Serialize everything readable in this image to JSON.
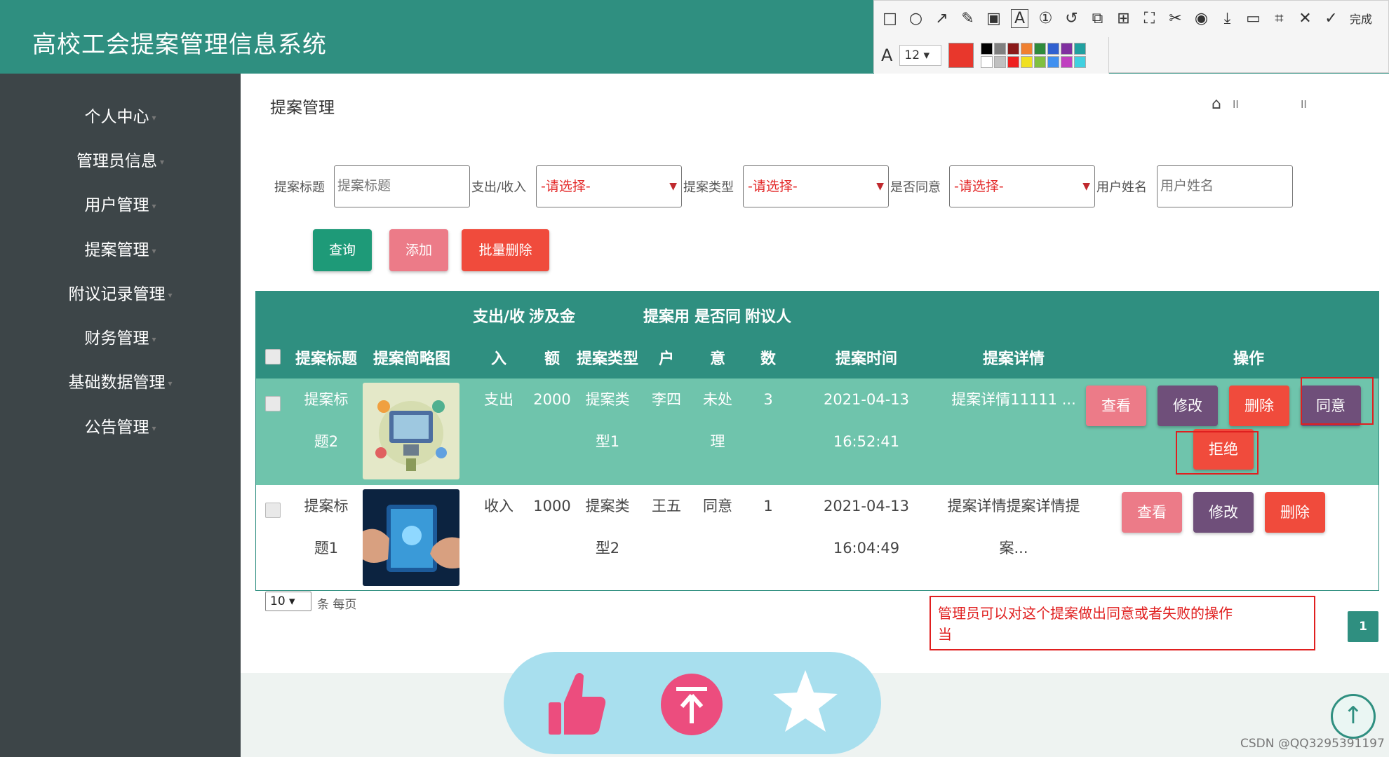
{
  "colors": {
    "primary": "#2f8f80",
    "sidebar": "#3d4548",
    "danger": "#f04b3c",
    "pink": "#ec7b88",
    "purple": "#6f4f7a",
    "row_highlight": "#6fc4ac"
  },
  "header": {
    "title": "高校工会提案管理信息系统"
  },
  "toolbar": {
    "done_label": "完成",
    "font_size": "12",
    "palette": [
      "#000000",
      "#808080",
      "#8b1a1a",
      "#f08030",
      "#2e8b3c",
      "#3060d0",
      "#8030a0",
      "#20a0a0",
      "#ffffff",
      "#c0c0c0",
      "#ee2020",
      "#f0e020",
      "#80c040",
      "#4090f0",
      "#c040c0",
      "#40d0e0"
    ]
  },
  "sidebar": {
    "items": [
      {
        "label": "个人中心"
      },
      {
        "label": "管理员信息"
      },
      {
        "label": "用户管理"
      },
      {
        "label": "提案管理"
      },
      {
        "label": "附议记录管理"
      },
      {
        "label": "财务管理"
      },
      {
        "label": "基础数据管理"
      },
      {
        "label": "公告管理"
      }
    ]
  },
  "page": {
    "heading": "提案管理",
    "breadcrumb_sep": "II"
  },
  "filters": {
    "title_label": "提案标题",
    "title_placeholder": "提案标题",
    "io_label": "支出/收入",
    "io_value": "-请选择-",
    "type_label": "提案类型",
    "type_value": "-请选择-",
    "agree_label": "是否同意",
    "agree_value": "-请选择-",
    "user_label": "用户姓名",
    "user_placeholder": "用户姓名"
  },
  "actions": {
    "query": "查询",
    "add": "添加",
    "batch_delete": "批量删除"
  },
  "table": {
    "headers": {
      "title": "提案标题",
      "image": "提案简略图",
      "io_top": "支出/收",
      "io_bot": "入",
      "amount_top": "涉及金",
      "amount_bot": "额",
      "type": "提案类型",
      "user_top": "提案用",
      "user_bot": "户",
      "agree_top": "是否同",
      "agree_bot": "意",
      "count_top": "附议人",
      "count_bot": "数",
      "time": "提案时间",
      "detail": "提案详情",
      "ops": "操作"
    },
    "rows": [
      {
        "title_1": "提案标",
        "title_2": "题2",
        "io": "支出",
        "amount": "2000",
        "type_1": "提案类",
        "type_2": "型1",
        "user": "李四",
        "agree_1": "未处",
        "agree_2": "理",
        "count": "3",
        "time_1": "2021-04-13",
        "time_2": "16:52:41",
        "detail": "提案详情11111 ...",
        "btn_view": "查看",
        "btn_edit": "修改",
        "btn_delete": "删除",
        "btn_agree": "同意",
        "btn_reject": "拒绝"
      },
      {
        "title_1": "提案标",
        "title_2": "题1",
        "io": "收入",
        "amount": "1000",
        "type_1": "提案类",
        "type_2": "型2",
        "user": "王五",
        "agree_1": "同意",
        "count": "1",
        "time_1": "2021-04-13",
        "time_2": "16:04:49",
        "detail_1": "提案详情提案详情提",
        "detail_2": "案...",
        "btn_view": "查看",
        "btn_edit": "修改",
        "btn_delete": "删除"
      }
    ]
  },
  "pagination": {
    "page_size": "10",
    "page_size_label": "条 每页",
    "current_page": "1"
  },
  "annotation": {
    "note_line1": "管理员可以对这个提案做出同意或者失败的操作",
    "note_line2": "当"
  },
  "watermark": "CSDN @QQ3295391197"
}
